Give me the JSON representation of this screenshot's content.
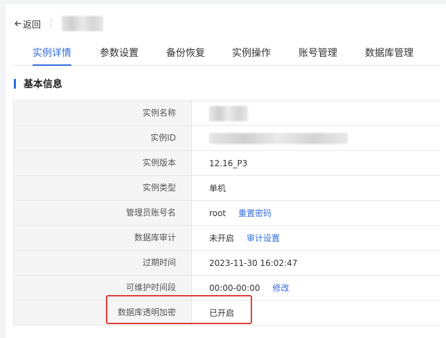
{
  "header": {
    "back_label": "返回"
  },
  "tabs": [
    {
      "label": "实例详情",
      "active": true
    },
    {
      "label": "参数设置",
      "active": false
    },
    {
      "label": "备份恢复",
      "active": false
    },
    {
      "label": "实例操作",
      "active": false
    },
    {
      "label": "账号管理",
      "active": false
    },
    {
      "label": "数据库管理",
      "active": false
    }
  ],
  "section": {
    "title": "基本信息"
  },
  "info": {
    "instance_name": {
      "label": "实例名称"
    },
    "instance_id": {
      "label": "实例ID"
    },
    "version": {
      "label": "实例版本",
      "value": "12.16_P3"
    },
    "type": {
      "label": "实例类型",
      "value": "单机"
    },
    "admin": {
      "label": "管理员账号名",
      "value": "root",
      "link": "重置密码"
    },
    "audit": {
      "label": "数据库审计",
      "value": "未开启",
      "link": "审计设置"
    },
    "expire": {
      "label": "过期时间",
      "value": "2023-11-30 16:02:47"
    },
    "maintenance": {
      "label": "可维护时间段",
      "value": "00:00-00:00",
      "link": "修改"
    },
    "tde": {
      "label": "数据库透明加密",
      "value": "已开启"
    }
  },
  "colors": {
    "accent": "#2f6bdd",
    "highlight": "#e53935"
  }
}
